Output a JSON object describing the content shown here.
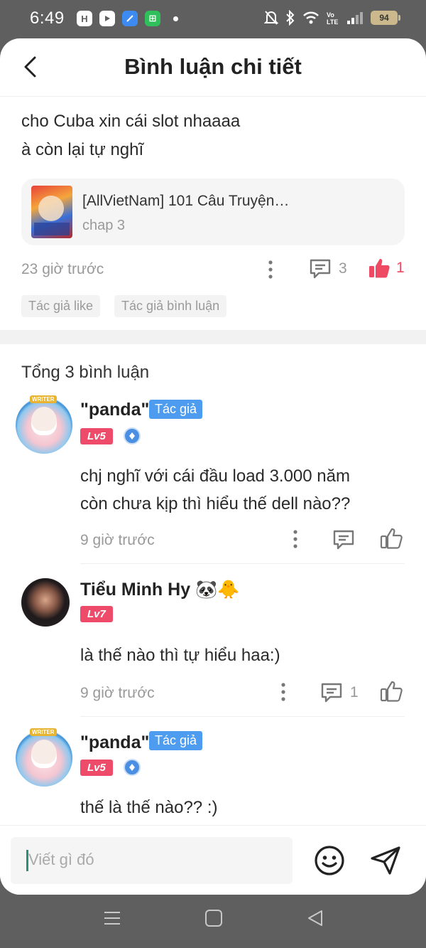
{
  "status_bar": {
    "time": "6:49",
    "app_icons": [
      "H",
      "",
      "",
      "⊞"
    ],
    "battery": "94"
  },
  "header": {
    "title": "Bình luận chi tiết"
  },
  "post": {
    "lines": [
      "cho Cuba xin cái slot nhaaaa",
      "à còn lại tự nghĩ"
    ],
    "story": {
      "title": "[AllVietNam] 101 Câu Truyện…",
      "chapter": "chap 3"
    },
    "time": "23 giờ trước",
    "reply_count": "3",
    "like_count": "1",
    "tags": [
      "Tác giả like",
      "Tác giả bình luận"
    ]
  },
  "comments_section": {
    "total_label": "Tổng 3 bình luận",
    "comments": [
      {
        "name": "\"panda\"",
        "author_badge": "Tác giả",
        "level": "Lv5",
        "text_lines": [
          "chj nghĩ với cái đầu load 3.000 năm",
          "còn chưa kịp thì hiểu thế dell nào??"
        ],
        "time": "9 giờ trước"
      },
      {
        "name": "Tiểu Minh Hy 🐼🐥",
        "level": "Lv7",
        "text_lines": [
          "là thế nào thì tự hiểu haa:)"
        ],
        "time": "9 giờ trước",
        "reply_count": "1"
      },
      {
        "name": "\"panda\"",
        "author_badge": "Tác giả",
        "level": "Lv5",
        "text_lines": [
          "thế là thế nào?? :)"
        ]
      }
    ]
  },
  "input_bar": {
    "placeholder": "Viết gì đó"
  },
  "colors": {
    "accent_like": "#ef4a63",
    "author_badge": "#4d9cf0",
    "level_badge": "#ee4b6a"
  },
  "icons": [
    "back-icon",
    "more-icon",
    "reply-icon",
    "like-icon",
    "emoji-icon",
    "send-icon",
    "menu-icon",
    "home-icon",
    "back-triangle-icon"
  ]
}
